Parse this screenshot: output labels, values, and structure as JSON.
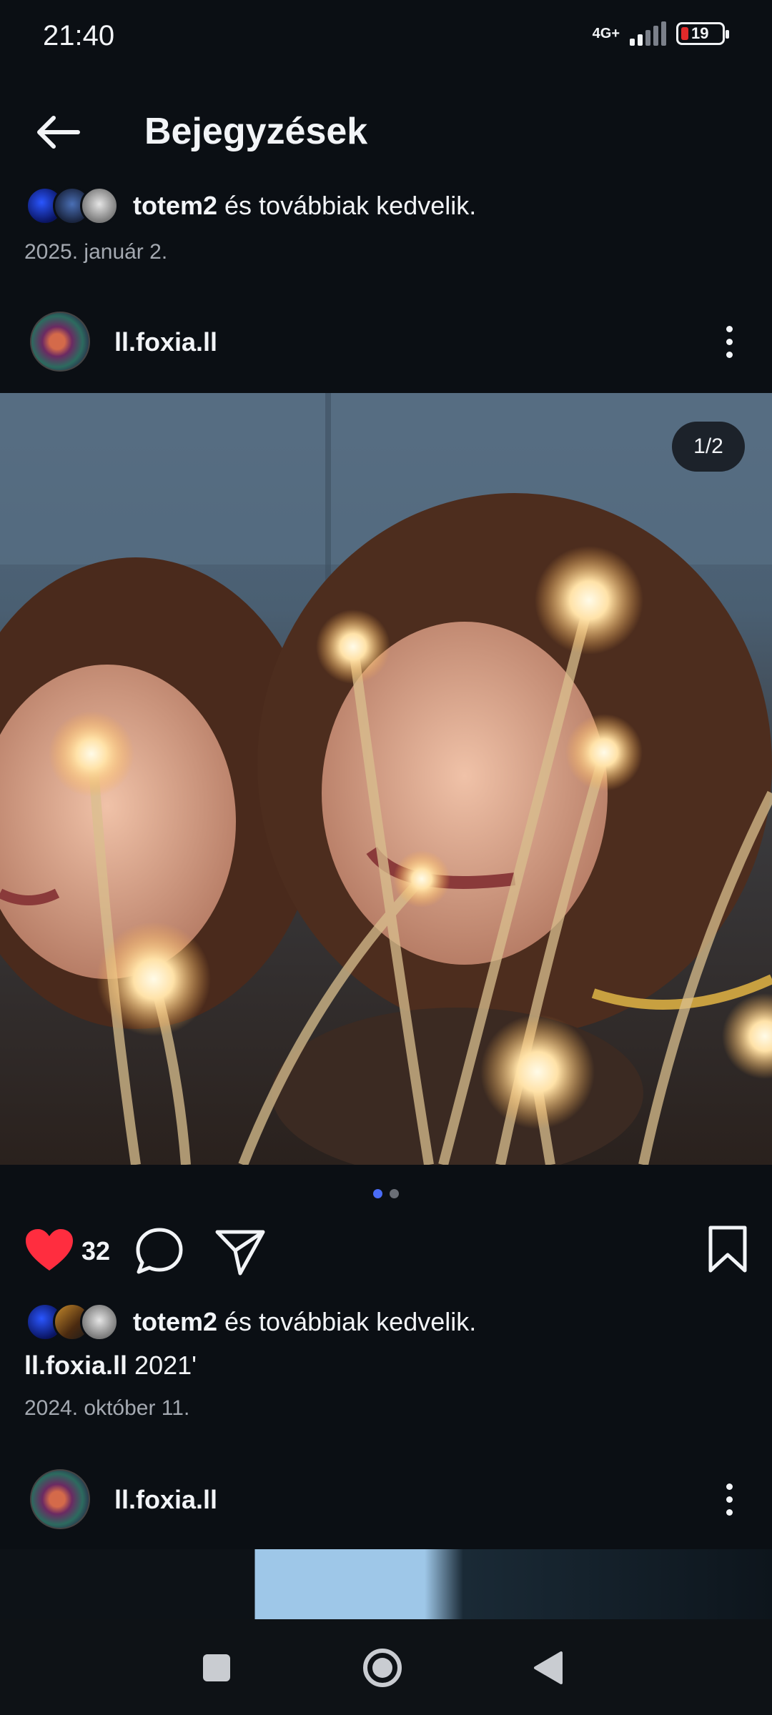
{
  "status_bar": {
    "time": "21:40",
    "network": "4G+",
    "battery": "19"
  },
  "header": {
    "title": "Bejegyzések"
  },
  "top_post": {
    "liked_by_user": "totem2",
    "liked_by_suffix": " és továbbiak kedvelik.",
    "date": "2025. január 2."
  },
  "post": {
    "username": "ll.foxia.ll",
    "image_counter": "1/2",
    "like_count": "32",
    "liked_by_user": "totem2",
    "liked_by_suffix": " és továbbiak kedvelik.",
    "caption_user": "ll.foxia.ll",
    "caption_text": " 2021'",
    "date": "2024. október 11."
  },
  "next_post": {
    "username": "ll.foxia.ll"
  },
  "icons": {
    "back": "arrow-left-icon",
    "more": "more-vertical-icon",
    "like": "heart-filled-icon",
    "comment": "comment-bubble-icon",
    "share": "paper-plane-icon",
    "save": "bookmark-icon",
    "nav_recents": "square-icon",
    "nav_home": "circle-icon",
    "nav_back": "triangle-back-icon"
  },
  "colors": {
    "background": "#0b0f14",
    "like_red": "#ff2d3f",
    "dot_active": "#4a6cf7"
  }
}
